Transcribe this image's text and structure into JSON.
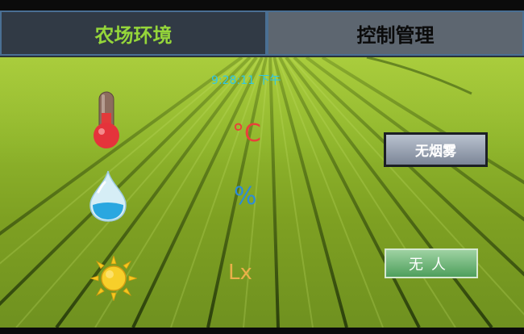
{
  "tabs": {
    "farm_env": "农场环境",
    "control": "控制管理"
  },
  "clock": "9:28:11 下午",
  "units": {
    "temperature": "°C",
    "humidity": "%",
    "light": "Lx"
  },
  "status": {
    "smoke": "无烟雾",
    "person": "无人"
  },
  "icons": {
    "temperature": "thermometer-icon",
    "humidity": "water-drop-icon",
    "light": "sun-icon"
  },
  "colors": {
    "active_tab_text": "#95d63a",
    "clock": "#2ec7e8",
    "temperature_unit": "#e8413a",
    "humidity_unit": "#2e8bd8",
    "light_unit": "#e9b04a"
  }
}
